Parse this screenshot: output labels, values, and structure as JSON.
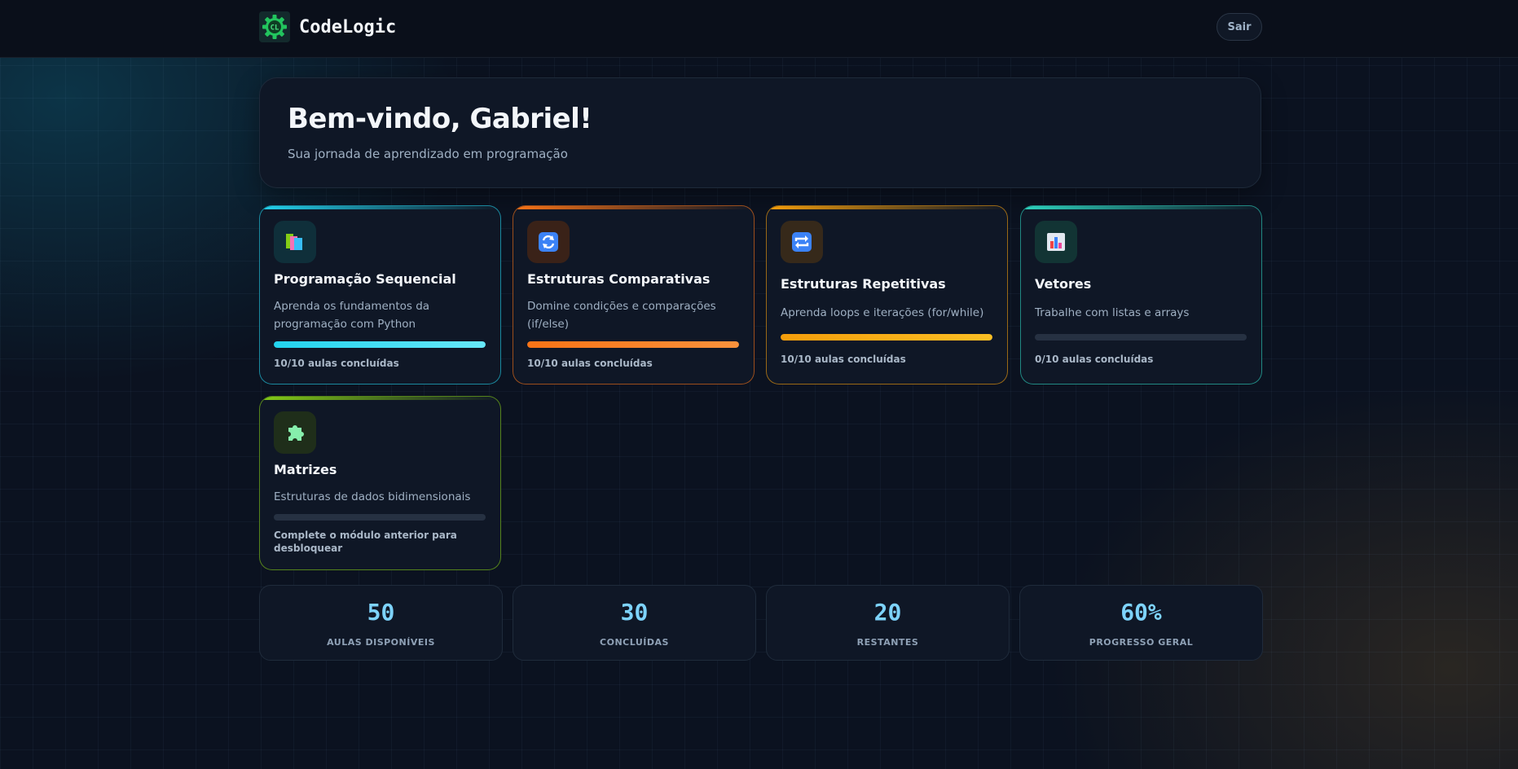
{
  "app": {
    "name": "CodeLogic",
    "logo_text": "CL"
  },
  "header": {
    "logout_label": "Sair"
  },
  "welcome": {
    "title": "Bem-vindo, Gabriel!",
    "subtitle": "Sua jornada de aprendizado em programação"
  },
  "modules": [
    {
      "icon": "books-icon",
      "title": "Programação Sequencial",
      "description": "Aprenda os fundamentos da programação com Python",
      "progress": 1.0,
      "status": "10/10 aulas concluídas",
      "accent": "#22d3ee",
      "accent2": "#67e8f9",
      "icon_bg": "#0f2f3a"
    },
    {
      "icon": "refresh-icon",
      "title": "Estruturas Comparativas",
      "description": "Domine condições e comparações (if/else)",
      "progress": 1.0,
      "status": "10/10 aulas concluídas",
      "accent": "#f97316",
      "accent2": "#fb923c",
      "icon_bg": "#3a2218"
    },
    {
      "icon": "repeat-icon",
      "title": "Estruturas Repetitivas",
      "description": "Aprenda loops e iterações (for/while)",
      "progress": 1.0,
      "status": "10/10 aulas concluídas",
      "accent": "#f59e0b",
      "accent2": "#fbbf24",
      "icon_bg": "#36291a"
    },
    {
      "icon": "bar-chart-icon",
      "title": "Vetores",
      "description": "Trabalhe com listas e arrays",
      "progress": 0.0,
      "status": "0/10 aulas concluídas",
      "accent": "#2dd4bf",
      "accent2": "#5eead4",
      "icon_bg": "#123434"
    },
    {
      "icon": "puzzle-icon",
      "title": "Matrizes",
      "description": "Estruturas de dados bidimensionais",
      "progress": 0.0,
      "status": "Complete o módulo anterior para desbloquear",
      "accent": "#84cc16",
      "accent2": "#a3e635",
      "icon_bg": "#1f2e1a"
    }
  ],
  "stats": [
    {
      "value": "50",
      "label": "AULAS DISPONÍVEIS"
    },
    {
      "value": "30",
      "label": "CONCLUÍDAS"
    },
    {
      "value": "20",
      "label": "RESTANTES"
    },
    {
      "value": "60%",
      "label": "PROGRESSO GERAL"
    }
  ]
}
